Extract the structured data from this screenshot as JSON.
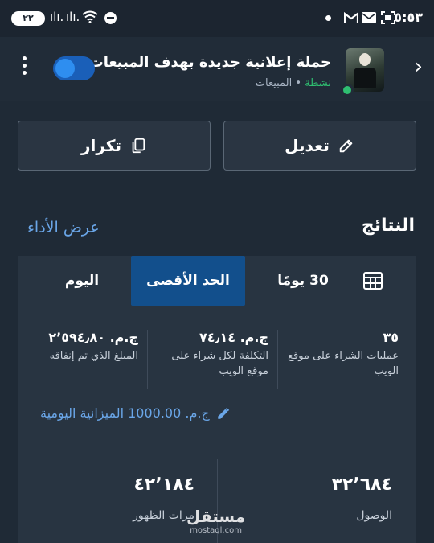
{
  "status_bar": {
    "time": "٥:٥٣",
    "battery": "٢٢",
    "signal_1": "ılı.",
    "signal_2": "ılı.",
    "icons": [
      "signal-icon",
      "wifi-icon",
      "dnd-icon",
      "gmail-icon",
      "mail-icon",
      "screenshot-icon"
    ]
  },
  "header": {
    "campaign_title": "حملة إعلانية جديدة بهدف المبيعات",
    "status": "نشطة",
    "separator": "•",
    "objective": "المبيعات",
    "toggle_on": true
  },
  "actions": {
    "edit_label": "تعديل",
    "duplicate_label": "تكرار"
  },
  "results": {
    "title": "النتائج",
    "view_performance": "عرض الأداء"
  },
  "tabs": {
    "today": "اليوم",
    "maximum": "الحد الأقصى",
    "last_30": "30 يومًا",
    "selected": "الحد الأقصى"
  },
  "metrics": [
    {
      "value": "٣٥",
      "label": "عمليات الشراء على موقع الويب"
    },
    {
      "value": "ج.م. ٧٤٫١٤",
      "label": "التكلفة لكل شراء على موقع الويب"
    },
    {
      "value": "ج.م. ٢٬٥٩٤٫٨٠",
      "label": "المبلغ الذي تم إنفاقه"
    }
  ],
  "daily_budget": {
    "text": "ج.م. 1000.00 الميزانية اليومية"
  },
  "big_metrics": [
    {
      "value": "٣٢٬٦٨٤",
      "label": "الوصول"
    },
    {
      "value": "٤٢٬١٨٤",
      "label": "مرات الظهور"
    }
  ],
  "watermark": {
    "brand": "مستقل",
    "domain": "mostaql.com"
  },
  "colors": {
    "background": "#1f2a36",
    "card": "#283441",
    "accent_blue": "#6aa6e8",
    "selected_tab": "#124f8c",
    "active_green": "#2fbf71",
    "toggle_track": "#1a5fb8"
  }
}
